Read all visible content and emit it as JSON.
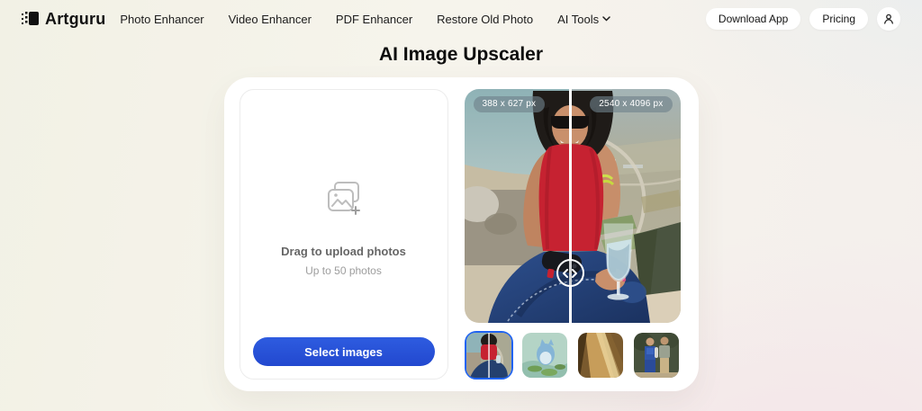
{
  "brand": {
    "name": "Artguru"
  },
  "nav": {
    "items": [
      {
        "label": "Photo Enhancer"
      },
      {
        "label": "Video Enhancer"
      },
      {
        "label": "PDF Enhancer"
      },
      {
        "label": "Restore Old Photo"
      },
      {
        "label": "AI Tools",
        "has_dropdown": true
      }
    ],
    "actions": [
      {
        "label": "Download App"
      },
      {
        "label": "Pricing"
      }
    ]
  },
  "page": {
    "title": "AI Image Upscaler"
  },
  "uploader": {
    "drag_text": "Drag to upload photos",
    "limit_text": "Up to 50 photos",
    "button_label": "Select images",
    "icon": "add-photos-icon"
  },
  "comparison": {
    "before_size_label": "388 x 627 px",
    "after_size_label": "2540 x 4096 px",
    "handle_icon": "horizontal-drag-arrows-icon"
  },
  "thumbnails": [
    {
      "name": "woman-red-top-photo",
      "selected": true
    },
    {
      "name": "anime-creature-artwork",
      "selected": false
    },
    {
      "name": "sepia-golden-artwork",
      "selected": false
    },
    {
      "name": "vintage-couple-photo",
      "selected": false
    }
  ],
  "colors": {
    "accent_blue": "#2a55d9",
    "selected_thumb_border": "#1f63f2",
    "page_bg_left": "#f2f1e5",
    "page_bg_right": "#f4efec"
  }
}
